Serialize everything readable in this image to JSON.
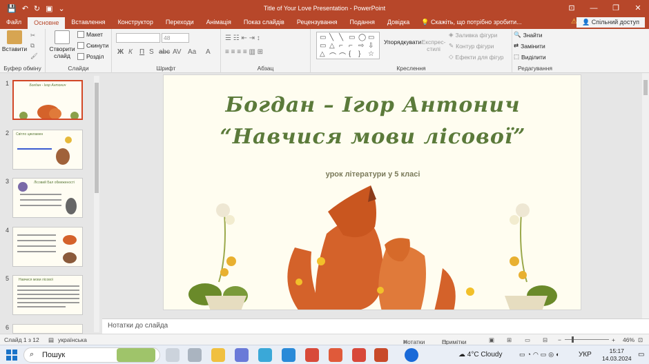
{
  "window": {
    "title": "Title of Your Love Presentation - PowerPoint"
  },
  "quick_access": [
    "save-icon",
    "undo-icon",
    "redo-icon",
    "present-icon",
    "more-icon"
  ],
  "window_controls": [
    "ribbon-options-icon",
    "minimize-icon",
    "restore-icon",
    "close-icon"
  ],
  "tabs": [
    "Файл",
    "Основне",
    "Вставлення",
    "Конструктор",
    "Переходи",
    "Анімація",
    "Показ слайдів",
    "Рецензування",
    "Подання",
    "Довідка"
  ],
  "tell_me": "Скажіть, що потрібно зробити...",
  "share": "Спільний доступ",
  "ribbon": {
    "clipboard": {
      "paste": "Вставити",
      "label": "Буфер обміну"
    },
    "slides": {
      "new_slide": "Створити слайд",
      "layout": "Макет",
      "reset": "Скинути",
      "section": "Розділ",
      "label": "Слайди"
    },
    "font": {
      "size": "48",
      "label": "Шрифт",
      "buttons": [
        "Ж",
        "К",
        "П",
        "S",
        "abc",
        "AV",
        "Aa",
        "A"
      ]
    },
    "paragraph": {
      "label": "Абзац"
    },
    "drawing": {
      "arrange": "Упорядкувати",
      "styles": "Експрес-стилі",
      "fill": "Заливка фігури",
      "outline": "Контур фігури",
      "effects": "Ефекти для фігур",
      "label": "Креслення"
    },
    "editing": {
      "find": "Знайти",
      "replace": "Замінити",
      "select": "Виділити",
      "label": "Редагування"
    }
  },
  "thumbnails": [
    {
      "num": "1",
      "title": "Богдан - Ігор Антонич"
    },
    {
      "num": "2",
      "title": "Світло цикламен"
    },
    {
      "num": "3",
      "title": "Лісовий Бал обмеженості"
    },
    {
      "num": "4",
      "title": ""
    },
    {
      "num": "5",
      "title": "Навчися мови лісової"
    },
    {
      "num": "6",
      "title": ""
    }
  ],
  "slide": {
    "line1": "Богдан – Ігор Антонич",
    "line2": "“Навчися мови лісової”",
    "subtitle": "урок літератури у 5 класі"
  },
  "notes": "Нотатки до слайда",
  "status": {
    "slide": "Слайд 1 з 12",
    "lang": "українська",
    "notes": "Нотатки",
    "comments": "Примітки",
    "zoom": "46%"
  },
  "taskbar": {
    "search": "Пошук",
    "weather": "4°C  Cloudy",
    "lang": "УКР",
    "time": "15:17",
    "date": "14.03.2024"
  },
  "colors": {
    "accent": "#b7472a",
    "slide_title": "#5b7a3a",
    "fox": "#d4622a"
  }
}
